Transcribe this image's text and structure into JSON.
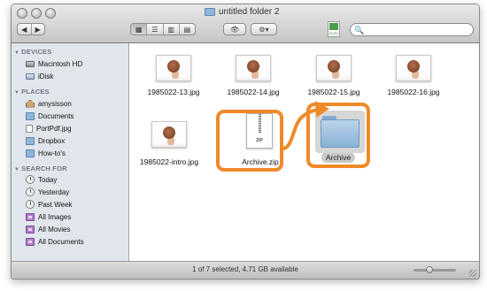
{
  "window": {
    "title": "untitled folder 2"
  },
  "toolbar": {
    "back_glyph": "◀",
    "forward_glyph": "▶",
    "view_glyphs": [
      "▦",
      "☰",
      "▥",
      "▤"
    ],
    "quicklook_glyph": "👁",
    "action_glyph": "⚙▾",
    "doc_icon_text": "XLSX",
    "search_placeholder": "",
    "search_glyph": "🔍"
  },
  "sidebar": {
    "devices": {
      "label": "DEVICES",
      "items": [
        "Macintosh HD",
        "iDisk"
      ]
    },
    "places": {
      "label": "PLACES",
      "items": [
        "amysisson",
        "Documents",
        "PortPdf.jpg",
        "Dropbox",
        "How-to's"
      ]
    },
    "search_for": {
      "label": "SEARCH FOR",
      "items": [
        "Today",
        "Yesterday",
        "Past Week",
        "All Images",
        "All Movies",
        "All Documents"
      ]
    }
  },
  "files": [
    "1985022-13.jpg",
    "1985022-14.jpg",
    "1985022-15.jpg",
    "1985022-16.jpg",
    "1985022-intro.jpg",
    "Archive.zip",
    "Archive"
  ],
  "zip_icon_text": "ZIP",
  "status": {
    "text": "1 of 7 selected, 4.71 GB available",
    "zoom_level": 0.35
  },
  "colors": {
    "highlight": "#ef8a2a",
    "sidebar_bg": "#e1e6ed",
    "folder": "#8ab2d6"
  }
}
